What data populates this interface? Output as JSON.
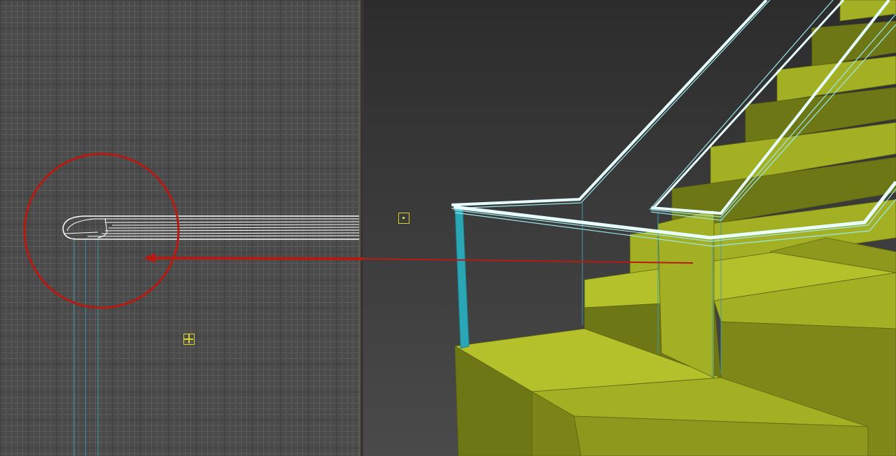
{
  "app": {
    "type": "3d-viewport-split",
    "viewports": [
      {
        "id": "left",
        "view": "orthographic-side",
        "grid": true
      },
      {
        "id": "right",
        "view": "perspective",
        "grid": false
      }
    ]
  },
  "colors": {
    "handrail": "#9be7ea",
    "stair_light": "#a4b024",
    "stair_dark": "#6e7716",
    "post": "#2aa6b5",
    "annotation": "#b81a12",
    "pivot": "#d9d22a"
  },
  "annotations": {
    "circle": "highlight-handrail-end",
    "arrow": "points-to-handrail-end"
  },
  "icons": [
    "pivot-marker-icon",
    "transform-gizmo-icon"
  ]
}
